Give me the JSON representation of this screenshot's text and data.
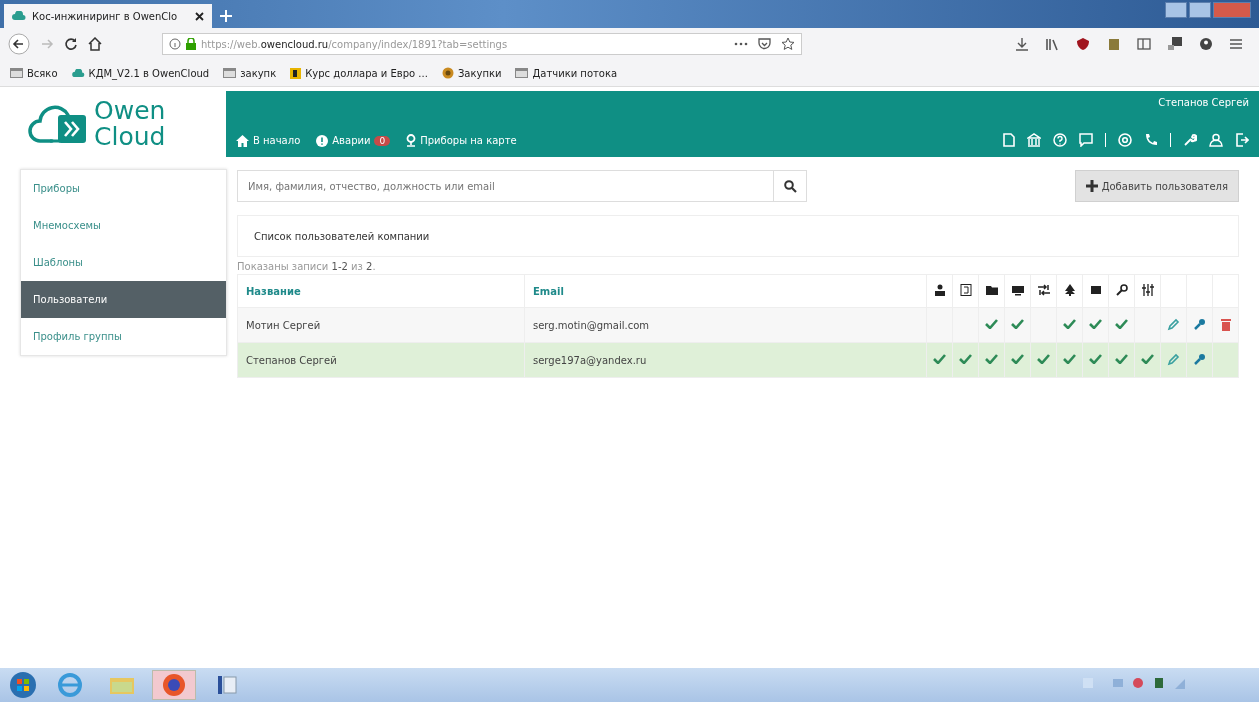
{
  "browser": {
    "tab_title": "Кос-инжиниринг в OwenClo",
    "url_prefix": "https://web.",
    "url_domain": "owencloud.ru",
    "url_rest": "/company/index/1891?tab=settings",
    "bookmarks": [
      {
        "label": "Всяко",
        "kind": "folder"
      },
      {
        "label": "КДМ_V2.1 в OwenCloud",
        "kind": "cloud"
      },
      {
        "label": "закупк",
        "kind": "folder"
      },
      {
        "label": "Курс доллара и Евро ...",
        "kind": "badge"
      },
      {
        "label": "Закупки",
        "kind": "globe"
      },
      {
        "label": "Датчики потока",
        "kind": "folder"
      }
    ]
  },
  "header": {
    "logo_top": "Owen",
    "logo_bottom": "Cloud",
    "nav": [
      {
        "label": "В начало",
        "kind": "home"
      },
      {
        "label": "Аварии",
        "kind": "alert",
        "badge": "0"
      },
      {
        "label": "Приборы на карте",
        "kind": "pin"
      }
    ],
    "user": "Степанов Сергей"
  },
  "sidebar": {
    "items": [
      {
        "label": "Приборы",
        "selected": false
      },
      {
        "label": "Мнемосхемы",
        "selected": false
      },
      {
        "label": "Шаблоны",
        "selected": false
      },
      {
        "label": "Пользователи",
        "selected": true
      },
      {
        "label": "Профиль группы",
        "selected": false
      }
    ]
  },
  "search": {
    "placeholder": "Имя, фамилия, отчество, должность или email"
  },
  "add_button": "Добавить пользователя",
  "panel_title": "Список пользователей компании",
  "summary": "Показаны записи **1-2** из **2**.",
  "table": {
    "columns": [
      "Название",
      "Email"
    ],
    "rows": [
      {
        "name": "Мотин Сергей",
        "email": "serg.motin@gmail.com",
        "highlighted": false,
        "permissions": [
          false,
          false,
          true,
          true,
          false,
          true,
          true,
          true,
          false
        ],
        "can_delete": true
      },
      {
        "name": "Степанов Сергей",
        "email": "serge197a@yandex.ru",
        "highlighted": true,
        "permissions": [
          true,
          true,
          true,
          true,
          true,
          true,
          true,
          true,
          true
        ],
        "can_delete": false
      }
    ]
  }
}
